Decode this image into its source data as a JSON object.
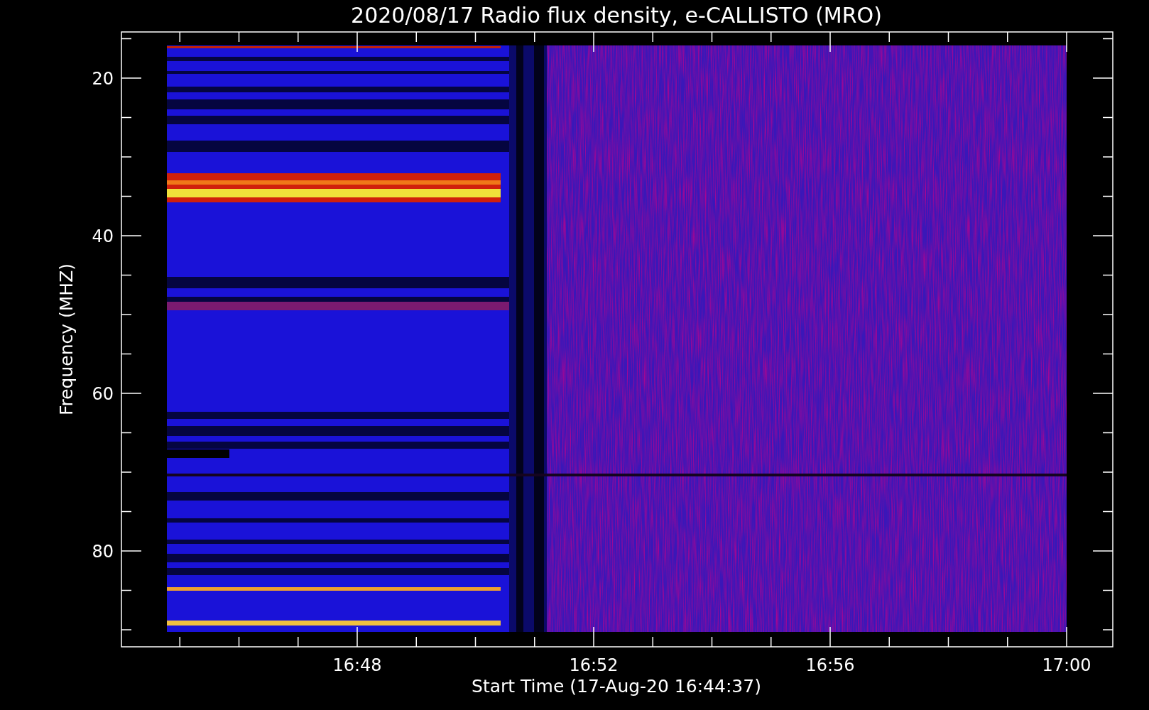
{
  "title": "2020/08/17  Radio flux density, e-CALLISTO (MRO)",
  "y_axis": {
    "label": "Frequency (MHZ)",
    "ticks": [
      "20",
      "40",
      "60",
      "80"
    ]
  },
  "x_axis": {
    "label": "Start Time (17-Aug-20 16:44:37)",
    "ticks": [
      "16:48",
      "16:52",
      "16:56",
      "17:00"
    ]
  }
}
